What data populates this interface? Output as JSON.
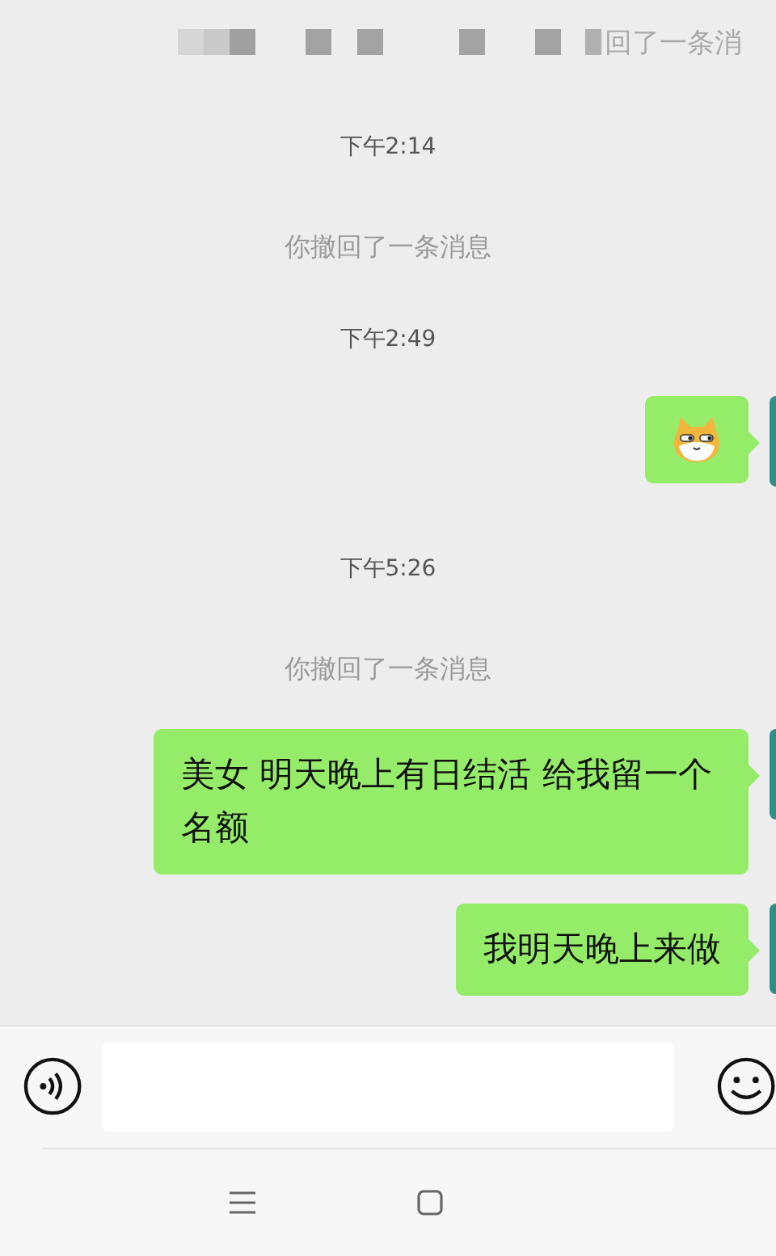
{
  "header": {
    "partial_text": "回了一条消"
  },
  "messages": [
    {
      "kind": "time",
      "text": "下午2:14"
    },
    {
      "kind": "system",
      "text": "你撤回了一条消息"
    },
    {
      "kind": "time",
      "text": "下午2:49"
    },
    {
      "kind": "sticker",
      "outgoing": true
    },
    {
      "kind": "time",
      "text": "下午5:26"
    },
    {
      "kind": "system",
      "text": "你撤回了一条消息"
    },
    {
      "kind": "text",
      "outgoing": true,
      "text": "美女 明天晚上有日结活 给我留一个名额"
    },
    {
      "kind": "text",
      "outgoing": true,
      "text": "我明天晚上来做"
    }
  ],
  "input": {
    "kind": "text"
  }
}
